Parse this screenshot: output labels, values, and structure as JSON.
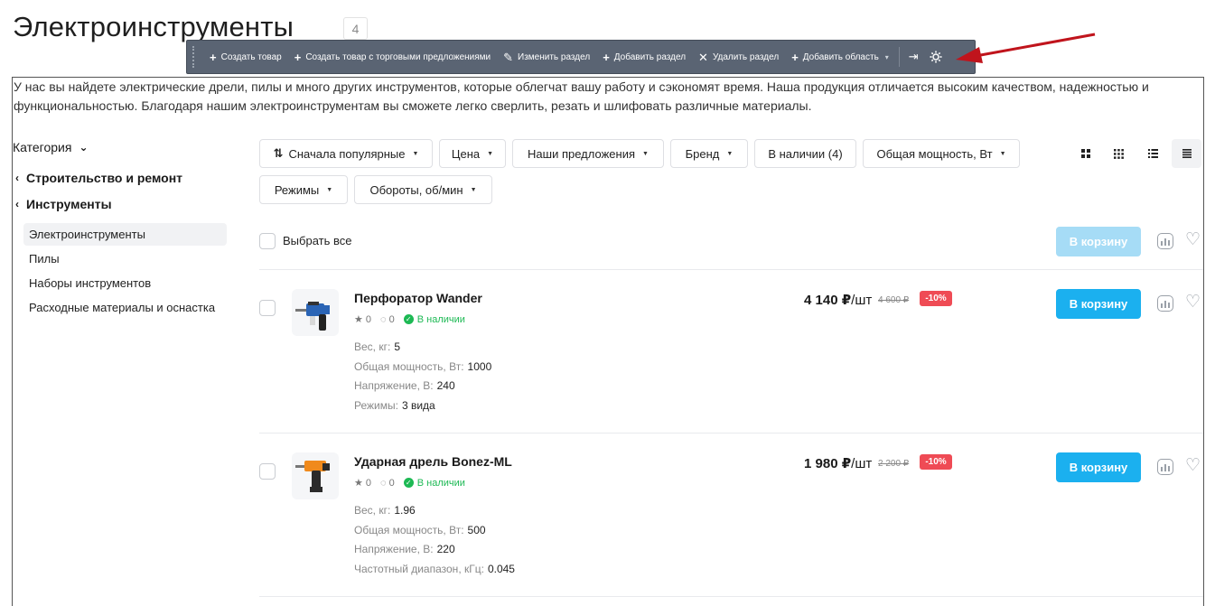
{
  "page": {
    "title": "Электроинструменты",
    "count": "4",
    "description": "У нас вы найдете электрические дрели, пилы и много других инструментов, которые облегчат вашу работу и сэкономят время. Наша продукция отличается высоким качеством, надежностью и функциональностью. Благодаря нашим электроинструментам вы сможете легко сверлить, резать и шлифовать различные материалы."
  },
  "toolbar": {
    "create_product": "Создать товар",
    "create_product_offers": "Создать товар с торговыми предложениями",
    "edit_section": "Изменить раздел",
    "add_section": "Добавить раздел",
    "delete_section": "Удалить раздел",
    "add_area": "Добавить область"
  },
  "sidebar": {
    "header": "Категория",
    "parents": [
      "Строительство и ремонт",
      "Инструменты"
    ],
    "items": [
      "Электроинструменты",
      "Пилы",
      "Наборы инструментов",
      "Расходные материалы и оснастка"
    ]
  },
  "filters": {
    "sort": "Сначала популярные",
    "price": "Цена",
    "offers": "Наши предложения",
    "brand": "Бренд",
    "in_stock": "В наличии (4)",
    "power": "Общая мощность, Вт",
    "modes": "Режимы",
    "rpm": "Обороты, об/мин"
  },
  "list": {
    "select_all": "Выбрать все",
    "cart_label": "В корзину"
  },
  "products": [
    {
      "name": "Перфоратор Wander",
      "rating": "0",
      "reviews": "0",
      "stock": "В наличии",
      "price": "4 140 ₽",
      "unit": "/шт",
      "old_price": "4 600 ₽",
      "discount": "-10%",
      "props": [
        {
          "label": "Вес, кг:",
          "value": "5"
        },
        {
          "label": "Общая мощность, Вт:",
          "value": "1000"
        },
        {
          "label": "Напряжение, В:",
          "value": "240"
        },
        {
          "label": "Режимы:",
          "value": "3 вида"
        }
      ],
      "cart": "В корзину"
    },
    {
      "name": "Ударная дрель Bonez-ML",
      "rating": "0",
      "reviews": "0",
      "stock": "В наличии",
      "price": "1 980 ₽",
      "unit": "/шт",
      "old_price": "2 200 ₽",
      "discount": "-10%",
      "props": [
        {
          "label": "Вес, кг:",
          "value": "1.96"
        },
        {
          "label": "Общая мощность, Вт:",
          "value": "500"
        },
        {
          "label": "Напряжение, В:",
          "value": "220"
        },
        {
          "label": "Частотный диапазон, кГц:",
          "value": "0.045"
        }
      ],
      "cart": "В корзину"
    }
  ],
  "colors": {
    "accent": "#1bb0ef",
    "discount": "#ef4b55",
    "stock": "#1db954",
    "toolbar": "#5a6473",
    "arrow": "#c0141c"
  }
}
